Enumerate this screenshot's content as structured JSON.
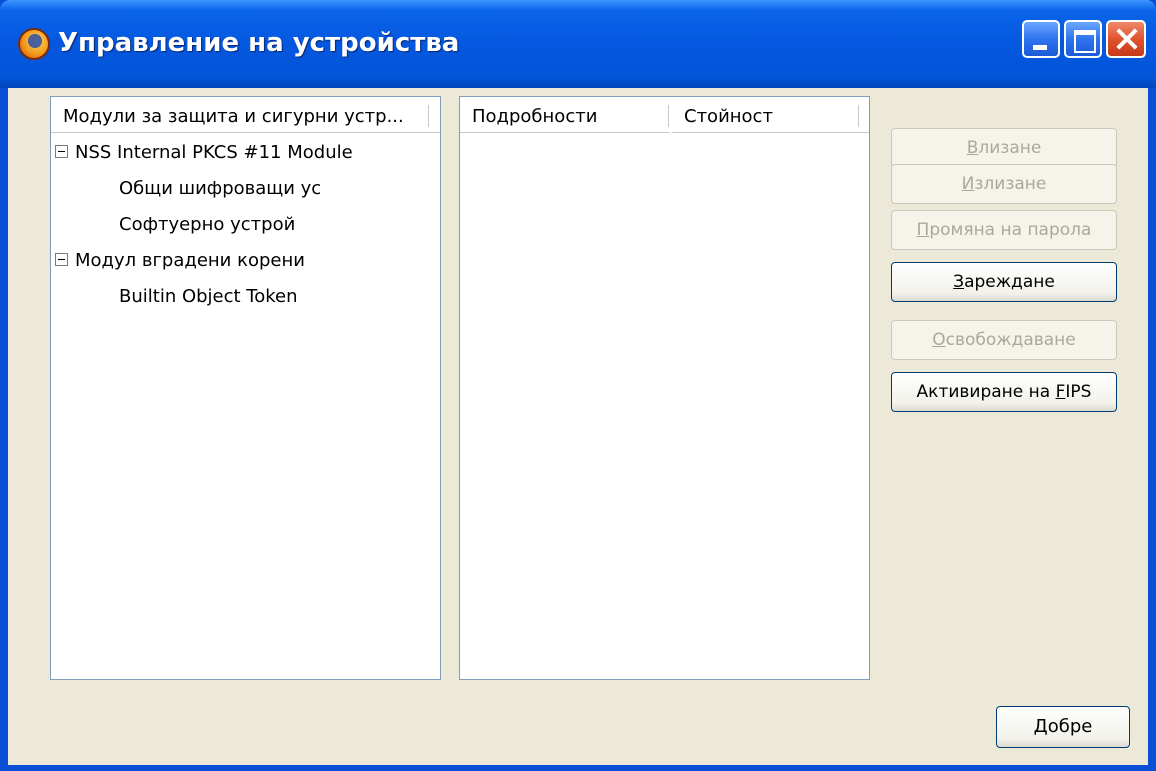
{
  "window": {
    "title": "Управление на устройства"
  },
  "left_panel": {
    "header": "Модули за защита и сигурни устр...",
    "tree": [
      {
        "label": "NSS Internal PKCS #11 Module",
        "level": 0,
        "expanded": true
      },
      {
        "label": "Общи шифроващи ус",
        "level": 1
      },
      {
        "label": "Софтуерно устрой",
        "level": 1
      },
      {
        "label": "Модул вградени корени",
        "level": 0,
        "expanded": true
      },
      {
        "label": "Builtin Object Token",
        "level": 1
      }
    ]
  },
  "middle_panel": {
    "col_details": "Подробности",
    "col_value": "Стойност"
  },
  "buttons": {
    "login": {
      "accel": "В",
      "rest": "лизане",
      "enabled": false
    },
    "logout": {
      "accel": "И",
      "rest": "злизане",
      "enabled": false
    },
    "change_password": {
      "accel": "П",
      "rest": "ромяна на парола",
      "enabled": false
    },
    "load": {
      "accel": "З",
      "rest": "ареждане",
      "enabled": true
    },
    "unload": {
      "accel": "О",
      "rest": "свобождаване",
      "enabled": false
    },
    "enable_fips": {
      "pre": "Активиране на ",
      "accel": "F",
      "rest": "IPS",
      "enabled": true
    },
    "ok": {
      "accel": "Д",
      "rest": "обре"
    }
  }
}
